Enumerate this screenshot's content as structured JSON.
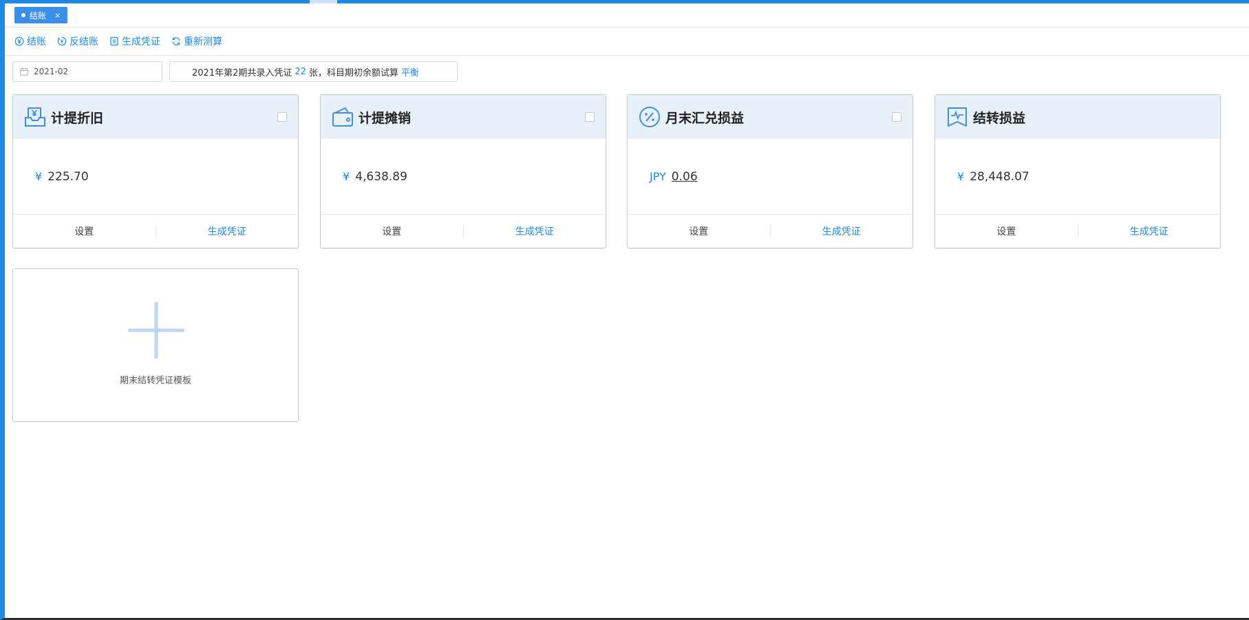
{
  "tabs": [
    {
      "label": "结账",
      "close": "×"
    }
  ],
  "toolbar": {
    "close_label": "结账",
    "reverse_label": "反结账",
    "generate_label": "生成凭证",
    "recalc_label": "重新测算"
  },
  "filter": {
    "period": "2021-02",
    "info_prefix": "2021年第2期共录入凭证",
    "voucher_count": "22",
    "info_mid": "张，科目期初余额试算",
    "balance_status": "平衡"
  },
  "cards": [
    {
      "title": "计提折旧",
      "currency": "¥",
      "amount": "225.70",
      "icon": "inbox-yen-icon",
      "set_label": "设置",
      "gen_label": "生成凭证"
    },
    {
      "title": "计提摊销",
      "currency": "¥",
      "amount": "4,638.89",
      "icon": "wallet-icon",
      "set_label": "设置",
      "gen_label": "生成凭证"
    },
    {
      "title": "月末汇兑损益",
      "currency": "JPY",
      "amount": "0.06",
      "icon": "exchange-icon",
      "set_label": "设置",
      "gen_label": "生成凭证"
    },
    {
      "title": "结转损益",
      "currency": "¥",
      "amount": "28,448.07",
      "icon": "pulse-flag-icon",
      "set_label": "设置",
      "gen_label": "生成凭证"
    }
  ],
  "add_template": {
    "label": "期末结转凭证模板"
  },
  "colors": {
    "accent": "#1e88e5",
    "card_header": "#e8f1fa"
  }
}
